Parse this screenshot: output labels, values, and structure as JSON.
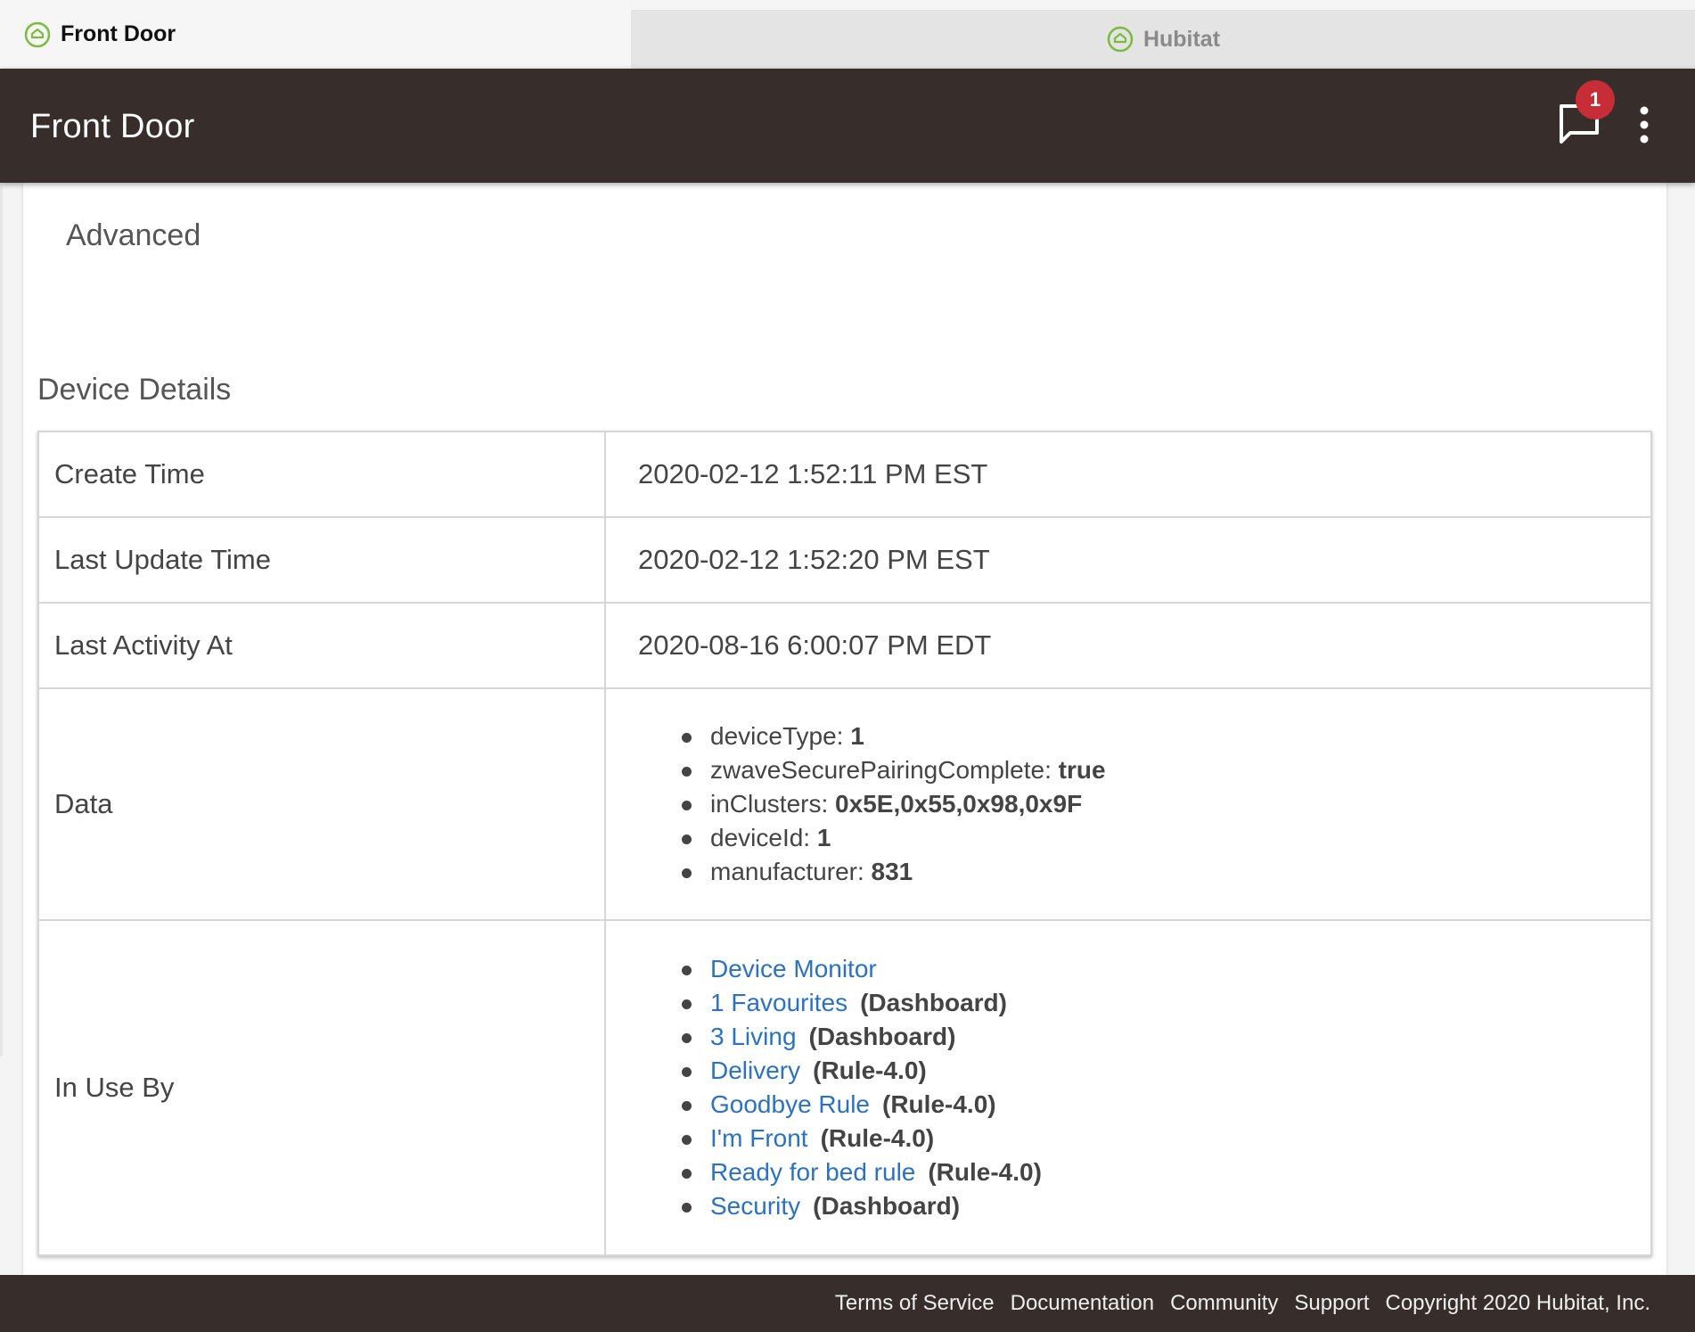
{
  "tabs": [
    {
      "label": "Front Door"
    },
    {
      "label": "Hubitat"
    }
  ],
  "appbar": {
    "title": "Front Door",
    "notification_count": "1",
    "chat_icon": "chat-bubble-icon",
    "menu_icon": "more-vert-icon"
  },
  "advanced_label": "Advanced",
  "device_details": {
    "title": "Device Details",
    "create_time": {
      "label": "Create Time",
      "value": "2020-02-12 1:52:11 PM EST"
    },
    "last_update_time": {
      "label": "Last Update Time",
      "value": "2020-02-12 1:52:20 PM EST"
    },
    "last_activity_at": {
      "label": "Last Activity At",
      "value": "2020-08-16 6:00:07 PM EDT"
    },
    "data": {
      "label": "Data",
      "items": [
        {
          "key": "deviceType",
          "value": "1"
        },
        {
          "key": "zwaveSecurePairingComplete",
          "value": "true"
        },
        {
          "key": "inClusters",
          "value": "0x5E,0x55,0x98,0x9F"
        },
        {
          "key": "deviceId",
          "value": "1"
        },
        {
          "key": "manufacturer",
          "value": "831"
        }
      ]
    },
    "in_use_by": {
      "label": "In Use By",
      "items": [
        {
          "name": "Device Monitor",
          "type": ""
        },
        {
          "name": "1 Favourites",
          "type": "(Dashboard)"
        },
        {
          "name": "3 Living",
          "type": "(Dashboard)"
        },
        {
          "name": "Delivery",
          "type": "(Rule-4.0)"
        },
        {
          "name": "Goodbye Rule",
          "type": "(Rule-4.0)"
        },
        {
          "name": "I'm Front",
          "type": "(Rule-4.0)"
        },
        {
          "name": "Ready for bed rule",
          "type": "(Rule-4.0)"
        },
        {
          "name": "Security",
          "type": "(Dashboard)"
        }
      ]
    }
  },
  "footer": {
    "links": [
      "Terms of Service",
      "Documentation",
      "Community",
      "Support"
    ],
    "copyright": "Copyright 2020 Hubitat, Inc."
  },
  "colors": {
    "appbar_bg": "#372e2c",
    "badge": "#c62d36",
    "link": "#2a72c3",
    "hubitat_green": "#7dbb3c"
  }
}
